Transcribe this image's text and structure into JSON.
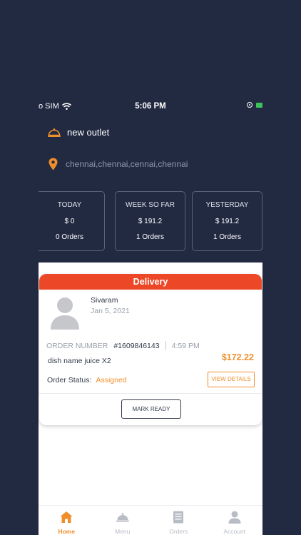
{
  "status_bar": {
    "carrier": "o SIM",
    "time": "5:06 PM"
  },
  "outlet": {
    "name": "new outlet",
    "address": "chennai,chennai,cennai,chennai"
  },
  "stats": [
    {
      "label": "TODAY",
      "amount": "$ 0",
      "orders": "0 Orders"
    },
    {
      "label": "WEEK SO FAR",
      "amount": "$ 191.2",
      "orders": "1 Orders"
    },
    {
      "label": "YESTERDAY",
      "amount": "$ 191.2",
      "orders": "1 Orders"
    }
  ],
  "order": {
    "type": "Delivery",
    "customer_name": "Sivaram",
    "date": "Jan 5, 2021",
    "order_number_label": "ORDER NUMBER",
    "order_number": "#1609846143",
    "time": "4:59 PM",
    "items": "dish name juice X2",
    "price": "$172.22",
    "status_label": "Order Status:",
    "status": "Assigned",
    "view_details_label": "VIEW DETAILS",
    "mark_ready_label": "MARK READY"
  },
  "tabs": [
    {
      "label": "Home",
      "icon": "home-icon",
      "active": true
    },
    {
      "label": "Menu",
      "icon": "cloche-icon",
      "active": false
    },
    {
      "label": "Orders",
      "icon": "document-icon",
      "active": false
    },
    {
      "label": "Account",
      "icon": "person-icon",
      "active": false
    }
  ],
  "colors": {
    "background": "#222a42",
    "accent": "#ef8f2c",
    "header_red": "#ec4726",
    "battery_green": "#3cc45a"
  }
}
